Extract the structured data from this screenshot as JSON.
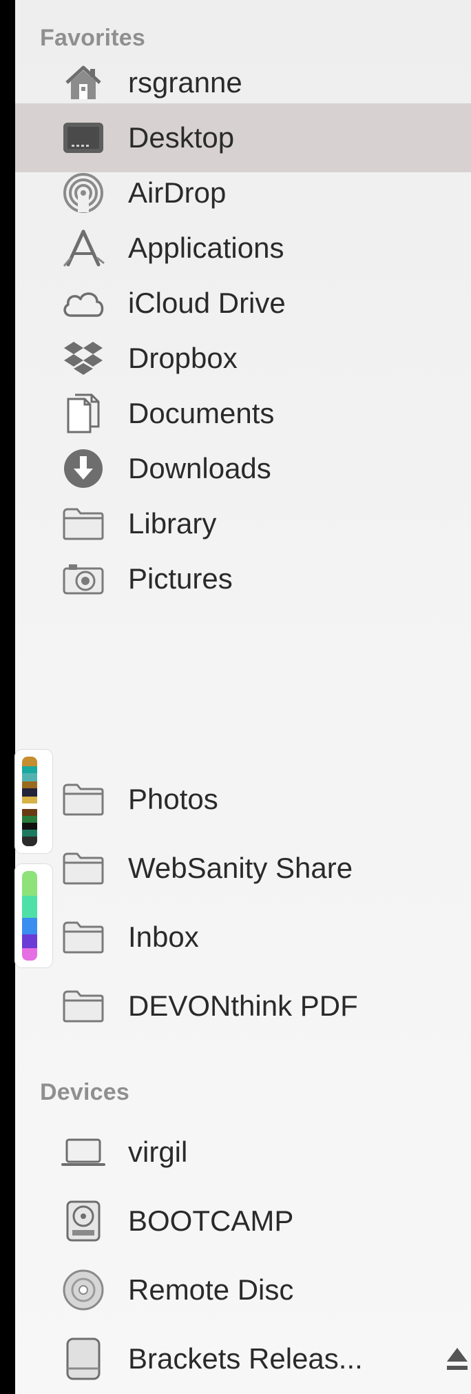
{
  "sidebar": {
    "favorites_title": "Favorites",
    "devices_title": "Devices",
    "favorites": [
      {
        "label": "rsgranne",
        "icon": "home-icon"
      },
      {
        "label": "Desktop",
        "icon": "desktop-icon",
        "selected": true
      },
      {
        "label": "AirDrop",
        "icon": "airdrop-icon"
      },
      {
        "label": "Applications",
        "icon": "applications-icon"
      },
      {
        "label": "iCloud Drive",
        "icon": "cloud-icon"
      },
      {
        "label": "Dropbox",
        "icon": "dropbox-icon"
      },
      {
        "label": "Documents",
        "icon": "documents-icon"
      },
      {
        "label": "Downloads",
        "icon": "downloads-icon"
      },
      {
        "label": "Library",
        "icon": "folder-icon"
      },
      {
        "label": "Pictures",
        "icon": "camera-icon"
      },
      {
        "label": "Photos",
        "icon": "folder-icon"
      },
      {
        "label": "WebSanity Share",
        "icon": "folder-icon"
      },
      {
        "label": "Inbox",
        "icon": "folder-icon"
      },
      {
        "label": "DEVONthink PDF",
        "icon": "folder-icon"
      }
    ],
    "devices": [
      {
        "label": "virgil",
        "icon": "laptop-icon"
      },
      {
        "label": "BOOTCAMP",
        "icon": "internal-disk-icon"
      },
      {
        "label": "Remote Disc",
        "icon": "remote-disc-icon"
      },
      {
        "label": "Brackets Releas...",
        "icon": "external-disk-icon",
        "eject": "eject-icon"
      }
    ]
  },
  "colors": {
    "sidebar_bg": "#f2f2f2",
    "selected_row": "#d8d1d1",
    "section_title": "#8f8f8f",
    "label": "#2a2a2a",
    "icon_gray": "#7a7a7a"
  }
}
